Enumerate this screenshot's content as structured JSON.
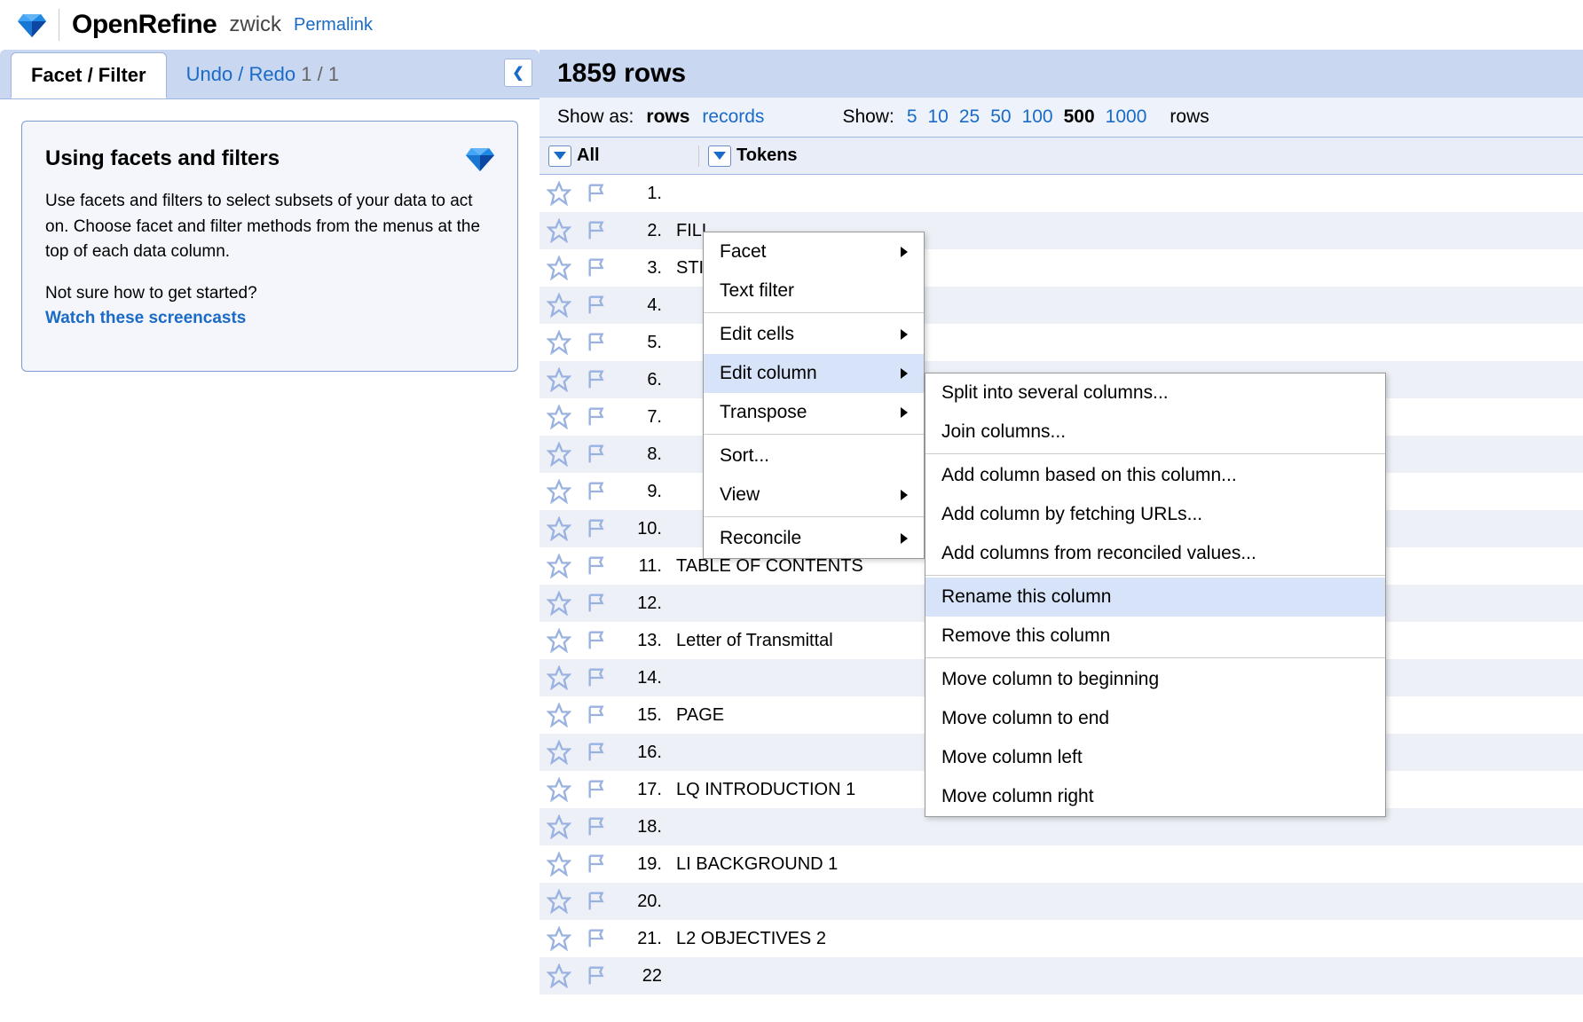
{
  "header": {
    "app_name": "OpenRefine",
    "project_name": "zwick",
    "permalink": "Permalink"
  },
  "left": {
    "tab_facet": "Facet / Filter",
    "tab_undo": "Undo / Redo",
    "undo_count": "1 / 1",
    "facet_title": "Using facets and filters",
    "facet_body": "Use facets and filters to select subsets of your data to act on. Choose facet and filter methods from the menus at the top of each data column.",
    "facet_q": "Not sure how to get started?",
    "facet_link": "Watch these screencasts"
  },
  "main": {
    "row_count": "1859 rows",
    "show_as_label": "Show as:",
    "mode_rows": "rows",
    "mode_records": "records",
    "show_label": "Show:",
    "page_sizes": [
      "5",
      "10",
      "25",
      "50",
      "100",
      "500",
      "1000"
    ],
    "selected_size": "500",
    "rows_word": "rows",
    "col_all": "All",
    "col_tokens": "Tokens",
    "rows": [
      {
        "n": "1.",
        "t": ""
      },
      {
        "n": "2.",
        "t": "FILL"
      },
      {
        "n": "3.",
        "t": "STIGATIONS"
      },
      {
        "n": "4.",
        "t": ""
      },
      {
        "n": "5.",
        "t": ""
      },
      {
        "n": "6.",
        "t": ""
      },
      {
        "n": "7.",
        "t": ""
      },
      {
        "n": "8.",
        "t": ""
      },
      {
        "n": "9.",
        "t": ""
      },
      {
        "n": "10.",
        "t": ""
      },
      {
        "n": "11.",
        "t": "TABLE OF CONTENTS"
      },
      {
        "n": "12.",
        "t": ""
      },
      {
        "n": "13.",
        "t": "Letter of Transmittal"
      },
      {
        "n": "14.",
        "t": ""
      },
      {
        "n": "15.",
        "t": "PAGE"
      },
      {
        "n": "16.",
        "t": ""
      },
      {
        "n": "17.",
        "t": "LQ INTRODUCTION 1"
      },
      {
        "n": "18.",
        "t": ""
      },
      {
        "n": "19.",
        "t": "LI BACKGROUND 1"
      },
      {
        "n": "20.",
        "t": ""
      },
      {
        "n": "21.",
        "t": "L2 OBJECTIVES 2"
      },
      {
        "n": "22",
        "t": ""
      }
    ]
  },
  "menu1": [
    {
      "label": "Facet",
      "sub": true
    },
    {
      "label": "Text filter"
    },
    {
      "sep": true
    },
    {
      "label": "Edit cells",
      "sub": true
    },
    {
      "label": "Edit column",
      "sub": true,
      "hl": true
    },
    {
      "label": "Transpose",
      "sub": true
    },
    {
      "sep": true
    },
    {
      "label": "Sort..."
    },
    {
      "label": "View",
      "sub": true
    },
    {
      "sep": true
    },
    {
      "label": "Reconcile",
      "sub": true
    }
  ],
  "menu2": [
    {
      "label": "Split into several columns..."
    },
    {
      "label": "Join columns..."
    },
    {
      "sep": true
    },
    {
      "label": "Add column based on this column..."
    },
    {
      "label": "Add column by fetching URLs..."
    },
    {
      "label": "Add columns from reconciled values..."
    },
    {
      "sep": true
    },
    {
      "label": "Rename this column",
      "hl": true
    },
    {
      "label": "Remove this column"
    },
    {
      "sep": true
    },
    {
      "label": "Move column to beginning"
    },
    {
      "label": "Move column to end"
    },
    {
      "label": "Move column left"
    },
    {
      "label": "Move column right"
    }
  ]
}
